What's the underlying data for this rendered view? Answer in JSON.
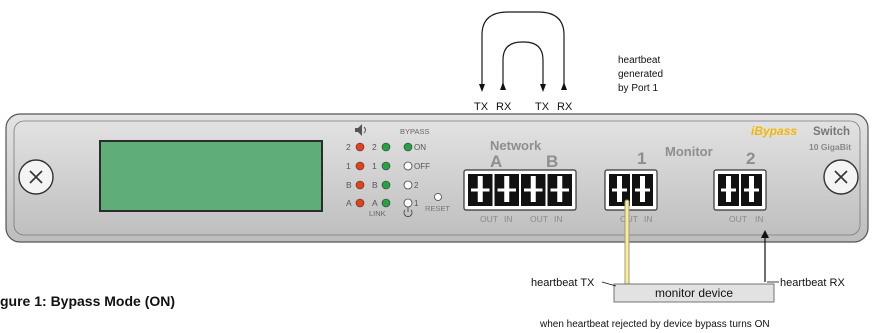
{
  "loop_labels": {
    "outer_left": "TX",
    "inner_left": "RX",
    "inner_right": "TX",
    "outer_right": "RX"
  },
  "heartbeat_note": [
    "heartbeat",
    "generated",
    "by Port 1"
  ],
  "brand": {
    "prefix_icon": "i",
    "name": "Bypass",
    "suffix": "Switch",
    "speed": "10 GigaBit",
    "accent_color": "#f2b705"
  },
  "status_panel": {
    "speaker_icon": "speaker-icon",
    "bypass_heading": "BYPASS",
    "rows": [
      {
        "left": "2",
        "mid": "2",
        "right": "ON"
      },
      {
        "left": "1",
        "mid": "1",
        "right": "OFF"
      },
      {
        "left": "B",
        "mid": "B",
        "right": "2"
      },
      {
        "left": "A",
        "mid": "A",
        "right": "1"
      }
    ],
    "link_label": "LINK",
    "power_icon": "power-icon",
    "reset_label": "RESET",
    "led_colors": {
      "red": "#e8401c",
      "green": "#27a046"
    }
  },
  "network": {
    "title": "Network",
    "port_a": "A",
    "port_b": "B"
  },
  "monitor": {
    "title": "Monitor",
    "port_1": "1",
    "port_2": "2"
  },
  "jack_labels": {
    "out": "OUT",
    "in": "IN"
  },
  "heartbeat_tx": "heartbeat TX",
  "heartbeat_rx": "heartbeat RX",
  "monitor_device": "monitor device",
  "footer_note": "when heartbeat rejected by device bypass turns ON",
  "caption": "gure 1: Bypass Mode (ON)",
  "colors": {
    "lcd": "#5fae77",
    "heartbeat_line": "#ffef82"
  }
}
